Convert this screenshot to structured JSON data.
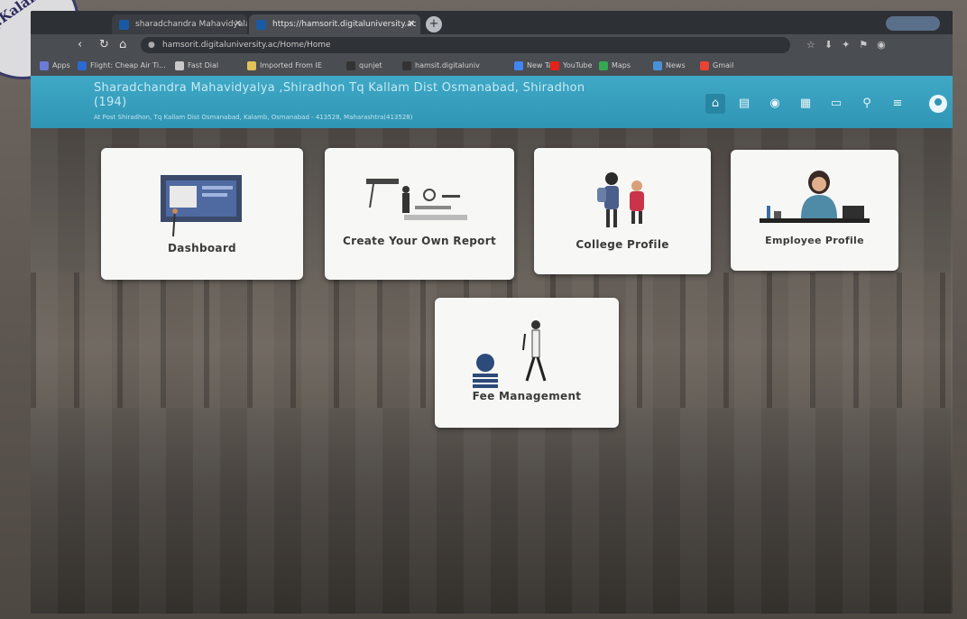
{
  "browser": {
    "tabs": [
      {
        "title": "sharadchandra Mahavidyalaya - Dashboard"
      },
      {
        "title": "https://hamsorit.digitaluniversity.ac"
      }
    ],
    "new_tab_label": "+",
    "url": "hamsorit.digitaluniversity.ac/Home/Home",
    "bookmarks": [
      {
        "label": "Apps",
        "color": "#6b7bd6"
      },
      {
        "label": "Flight: Cheap Air Ti...",
        "color": "#2b6ad1"
      },
      {
        "label": "Fast Dial",
        "color": "#c9c9c9"
      },
      {
        "label": "Imported From IE",
        "color": "#e0c15a"
      },
      {
        "label": "qunjet",
        "color": "#333333"
      },
      {
        "label": "hamsit.digitaluniv",
        "color": "#333333"
      },
      {
        "label": "New Tab",
        "color": "#4285f4"
      },
      {
        "label": "YouTube",
        "color": "#e62117"
      },
      {
        "label": "Maps",
        "color": "#34a853"
      },
      {
        "label": "News",
        "color": "#4a90d9"
      },
      {
        "label": "Gmail",
        "color": "#ea4335"
      }
    ]
  },
  "header": {
    "title_line1": "Sharadchandra Mahavidyalya ,Shiradhon Tq Kallam Dist Osmanabad, Shiradhon",
    "title_line2": "(194)",
    "address": "At Post Shiradhon, Tq Kallam Dist Osmanabad, Kalamb, Osmanabad - 413528, Maharashtra(413528)",
    "accent_color": "#3fa9c6",
    "icons": [
      "home-icon",
      "book-icon",
      "chat-icon",
      "building-icon",
      "id-card-icon",
      "search-icon",
      "menu-icon",
      "user-icon"
    ]
  },
  "tiles": [
    {
      "label": "Dashboard"
    },
    {
      "label": "Create Your Own Report"
    },
    {
      "label": "College Profile"
    },
    {
      "label": "Employee Profile"
    },
    {
      "label": "Fee Management"
    }
  ]
}
